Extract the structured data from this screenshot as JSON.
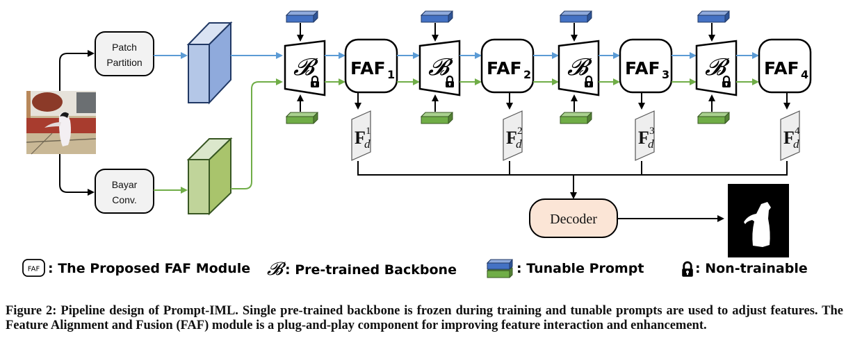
{
  "figure": {
    "input_image": "input-penguin-image",
    "output_mask": "predicted-mask-image",
    "patch_partition": {
      "line1": "Patch",
      "line2": "Partition"
    },
    "bayar_conv": {
      "line1": "Bayar",
      "line2": "Conv."
    },
    "backbone_symbol": "𝓑",
    "faf_modules": [
      {
        "label": "FAF",
        "sub": "1"
      },
      {
        "label": "FAF",
        "sub": "2"
      },
      {
        "label": "FAF",
        "sub": "3"
      },
      {
        "label": "FAF",
        "sub": "4"
      }
    ],
    "features": [
      {
        "main": "F",
        "sub": "d",
        "sup": "1"
      },
      {
        "main": "F",
        "sub": "d",
        "sup": "2"
      },
      {
        "main": "F",
        "sub": "d",
        "sup": "3"
      },
      {
        "main": "F",
        "sub": "d",
        "sup": "4"
      }
    ],
    "decoder_label": "Decoder",
    "colors": {
      "rgb_stream": "#5b9bd5",
      "noise_stream": "#70ad47",
      "prompt_blue": "#4472c4",
      "prompt_green": "#70ad47",
      "decoder_fill": "#fbe5d6",
      "feature_fill": "#eeeeee"
    }
  },
  "legend": {
    "faf_icon_text": "FAF",
    "faf_desc": ": The Proposed FAF Module",
    "backbone_symbol": "𝓑",
    "backbone_desc": ": Pre-trained Backbone",
    "prompt_desc": ": Tunable Prompt",
    "lock_desc": ": Non-trainable"
  },
  "caption": "Figure 2: Pipeline design of Prompt-IML. Single pre-trained backbone is frozen during training and tunable prompts are used to adjust features. The Feature Alignment and Fusion (FAF) module is a plug-and-play component for improving feature interaction and enhancement."
}
